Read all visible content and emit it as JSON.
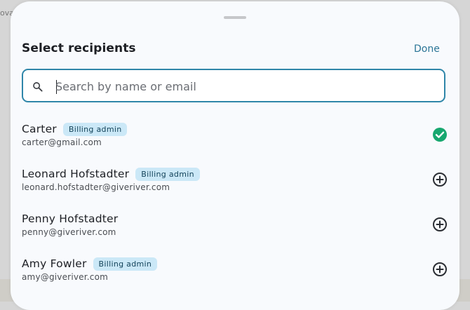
{
  "backdrop": {
    "partial_text": "oval"
  },
  "sheet": {
    "title": "Select recipients",
    "done_label": "Done",
    "search": {
      "placeholder": "Search by name or email",
      "value": "",
      "icon": "search-icon"
    }
  },
  "recipients": [
    {
      "name": "Carter",
      "badge": "Billing admin",
      "email": "carter@gmail.com",
      "selected": true,
      "icon": "check-circle-icon"
    },
    {
      "name": "Leonard Hofstadter",
      "badge": "Billing admin",
      "email": "leonard.hofstadter@giveriver.com",
      "selected": false,
      "icon": "add-circle-icon"
    },
    {
      "name": "Penny Hofstadter",
      "badge": "",
      "email": "penny@giveriver.com",
      "selected": false,
      "icon": "add-circle-icon"
    },
    {
      "name": "Amy Fowler",
      "badge": "Billing admin",
      "email": "amy@giveriver.com",
      "selected": false,
      "icon": "add-circle-icon"
    }
  ],
  "colors": {
    "accent": "#2f86a9",
    "selected_check": "#17a76f",
    "badge_bg": "#cbe8f7",
    "badge_text": "#13435a"
  }
}
